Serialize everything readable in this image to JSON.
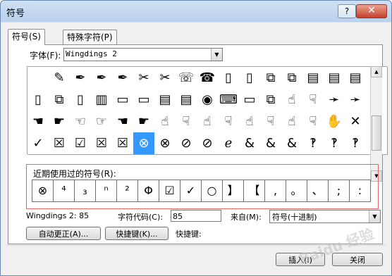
{
  "window": {
    "title": "符号",
    "help": "?",
    "close": "✕"
  },
  "tabs": [
    {
      "label": "符号(S)"
    },
    {
      "label": "特殊字符(P)"
    }
  ],
  "font": {
    "label": "字体(F):",
    "value": "Wingdings 2"
  },
  "symbol_grid": {
    "rows": [
      [
        "",
        "✎",
        "✒",
        "✒",
        "✒",
        "✂",
        "✂",
        "☏",
        "☎",
        "▯",
        "▯",
        "⧉",
        "⧉",
        "▤",
        "▤",
        "▤",
        "▯"
      ],
      [
        "▯",
        "⧉",
        "▯",
        "▥",
        "▭",
        "▭",
        "▤",
        "▤",
        "◉",
        "⌨",
        "▭",
        "⧉",
        "☝",
        "☟",
        "➛",
        "➛",
        ""
      ],
      [
        "☚",
        "☛",
        "☜",
        "☞",
        "☚",
        "☛",
        "☝",
        "☟",
        "☝",
        "☟",
        "☝",
        "☟",
        "☝",
        "☟",
        "✋",
        "✕",
        ""
      ],
      [
        "✓",
        "☒",
        "☑",
        "☒",
        "☒",
        "⊗",
        "⊗",
        "⊘",
        "⊘",
        "ℯ",
        "&",
        "&",
        "&",
        "‽",
        "‽",
        "‽",
        ""
      ]
    ],
    "selected_cell": {
      "row": 3,
      "col": 5
    }
  },
  "recent": {
    "label": "近期使用过的符号(R):",
    "items": [
      "⊗",
      "⁴",
      "₃",
      "ⁿ",
      "²",
      "Φ",
      "☑",
      "✓",
      "○",
      "】",
      "【",
      ",",
      "。",
      "、",
      ";",
      ":"
    ]
  },
  "info": {
    "char_name": "Wingdings 2: 85",
    "char_code_label": "字符代码(C):",
    "char_code": "85",
    "from_label": "来自(M):",
    "from_value": "符号(十进制)"
  },
  "buttons": {
    "autocorrect": "自动更正(A)...",
    "shortcut_key": "快捷键(K)...",
    "shortcut_label": "快捷键:",
    "insert": "插入(I)",
    "close": "关闭"
  },
  "watermark": "Baidu 经验"
}
